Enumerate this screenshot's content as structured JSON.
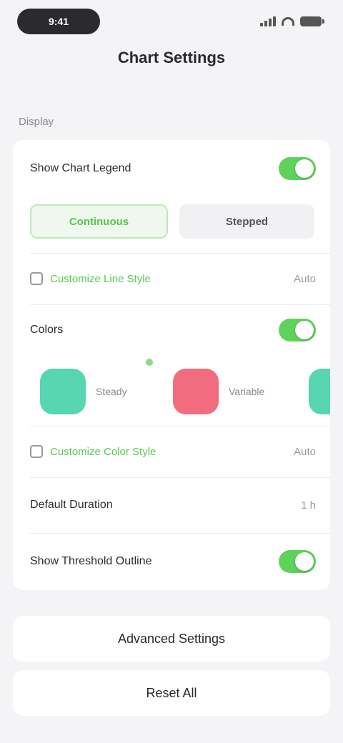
{
  "status_bar": {
    "time": "9:41"
  },
  "page": {
    "title": "Chart Settings",
    "section_label": "Display"
  },
  "card": {
    "row_show_legend": {
      "label": "Show Chart Legend",
      "on": true
    },
    "segments": [
      {
        "label": "Continuous",
        "active": true
      },
      {
        "label": "Stepped",
        "active": false
      }
    ],
    "row_line_style": {
      "link": "Customize Line Style",
      "value": "Auto"
    },
    "row_colors": {
      "label": "Colors",
      "on": true
    },
    "swatches": [
      {
        "name": "Steady",
        "color": "#57d6b1"
      },
      {
        "name": "Variable",
        "color": "#f16c7f"
      },
      {
        "name": "",
        "color": "#57d6b1"
      }
    ],
    "row_color_style": {
      "link": "Customize Color Style",
      "value": "Auto"
    },
    "row_default_duration": {
      "label": "Default Duration",
      "value": "1 h"
    },
    "row_color_outline": {
      "label": "Show Threshold Outline",
      "on": true
    }
  },
  "buttons": {
    "primary": "Advanced Settings",
    "secondary": "Reset All"
  },
  "colors": {
    "accent": "#5fd25c",
    "background": "#f4f4f6"
  }
}
